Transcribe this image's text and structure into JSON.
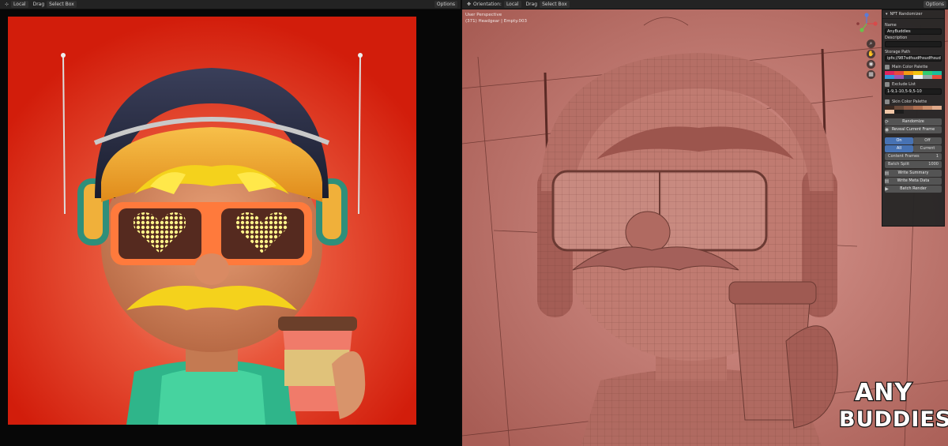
{
  "left_header": {
    "view_label": "Local",
    "drag_label": "Drag",
    "select_label": "Select Box",
    "options_label": "Options"
  },
  "right_header": {
    "orientation_label": "Orientation:",
    "orientation_value": "Local",
    "drag_label": "Drag",
    "select_label": "Select Box",
    "options_label": "Options"
  },
  "viewport": {
    "perspective": "User Perspective",
    "object_info": "(371) Headgear | Empty.003"
  },
  "npanel": {
    "title": "NFT Randomizer",
    "name_label": "Name",
    "name_value": "AnyBuddies",
    "description_label": "Description",
    "description_value": "",
    "storage_label": "Storage Path",
    "storage_value": "ipfs://987sdfsudfhsudfhsud",
    "main_palette_label": "Main Color Palette",
    "main_palette_colors": [
      "#e0245e",
      "#e84a3c",
      "#f39c12",
      "#f1c40f",
      "#2ecc71",
      "#1abc9c",
      "#3498db",
      "#9b59b6",
      "#34495e",
      "#ecf0f1",
      "#95a5a6",
      "#e74c3c"
    ],
    "exclude_label": "Exclude List",
    "exclude_value": "1-9,1-10,5-9,5-10",
    "skin_palette_label": "Skin Color Palette",
    "skin_palette_colors": [
      "#3b2a22",
      "#6b4a3a",
      "#8d5a45",
      "#b07052",
      "#c98d6b",
      "#e0a98a",
      "#f2c7a8",
      "#1c1c1c"
    ],
    "randomize_label": "Randomize",
    "reveal_label": "Reveal Current Frame",
    "toggle1_on": "On",
    "toggle1_off": "Off",
    "toggle2_all": "All",
    "toggle2_current": "Current",
    "content_frames_label": "Content Frames",
    "content_frames_value": "1",
    "batch_split_label": "Batch Split",
    "batch_split_value": "1000",
    "write_summary_label": "Write Summary",
    "write_meta_label": "Write Meta Data",
    "batch_render_label": "Batch Render"
  },
  "logo": {
    "line1": "ANY",
    "line2": "BUDDIES"
  }
}
